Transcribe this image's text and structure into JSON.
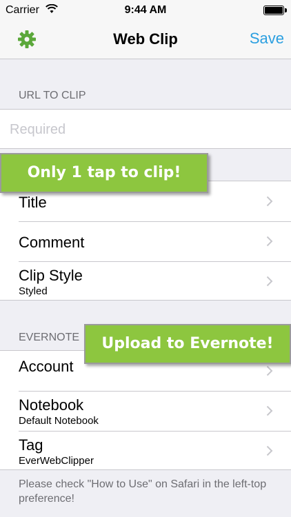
{
  "status_bar": {
    "carrier": "Carrier",
    "time": "9:44 AM"
  },
  "nav": {
    "title": "Web Clip",
    "save_label": "Save",
    "left_icon": "gear-icon",
    "accent_color": "#2b9fe0",
    "gear_color": "#5ba83a"
  },
  "url_section": {
    "header": "URL TO CLIP",
    "placeholder": "Required"
  },
  "details": {
    "items": [
      {
        "label": "Title"
      },
      {
        "label": "Comment"
      },
      {
        "label": "Clip Style",
        "detail": "Styled"
      }
    ]
  },
  "evernote_section": {
    "header": "EVERNOTE",
    "items": [
      {
        "label": "Account"
      },
      {
        "label": "Notebook",
        "detail": "Default Notebook"
      },
      {
        "label": "Tag",
        "detail": "EverWebClipper"
      }
    ]
  },
  "footer": {
    "note": "Please check \"How to Use\" on Safari in the left-top preference!"
  },
  "banners": {
    "tap": "Only 1 tap to clip!",
    "upload": "Upload to Evernote!",
    "color": "#8dc63f"
  }
}
